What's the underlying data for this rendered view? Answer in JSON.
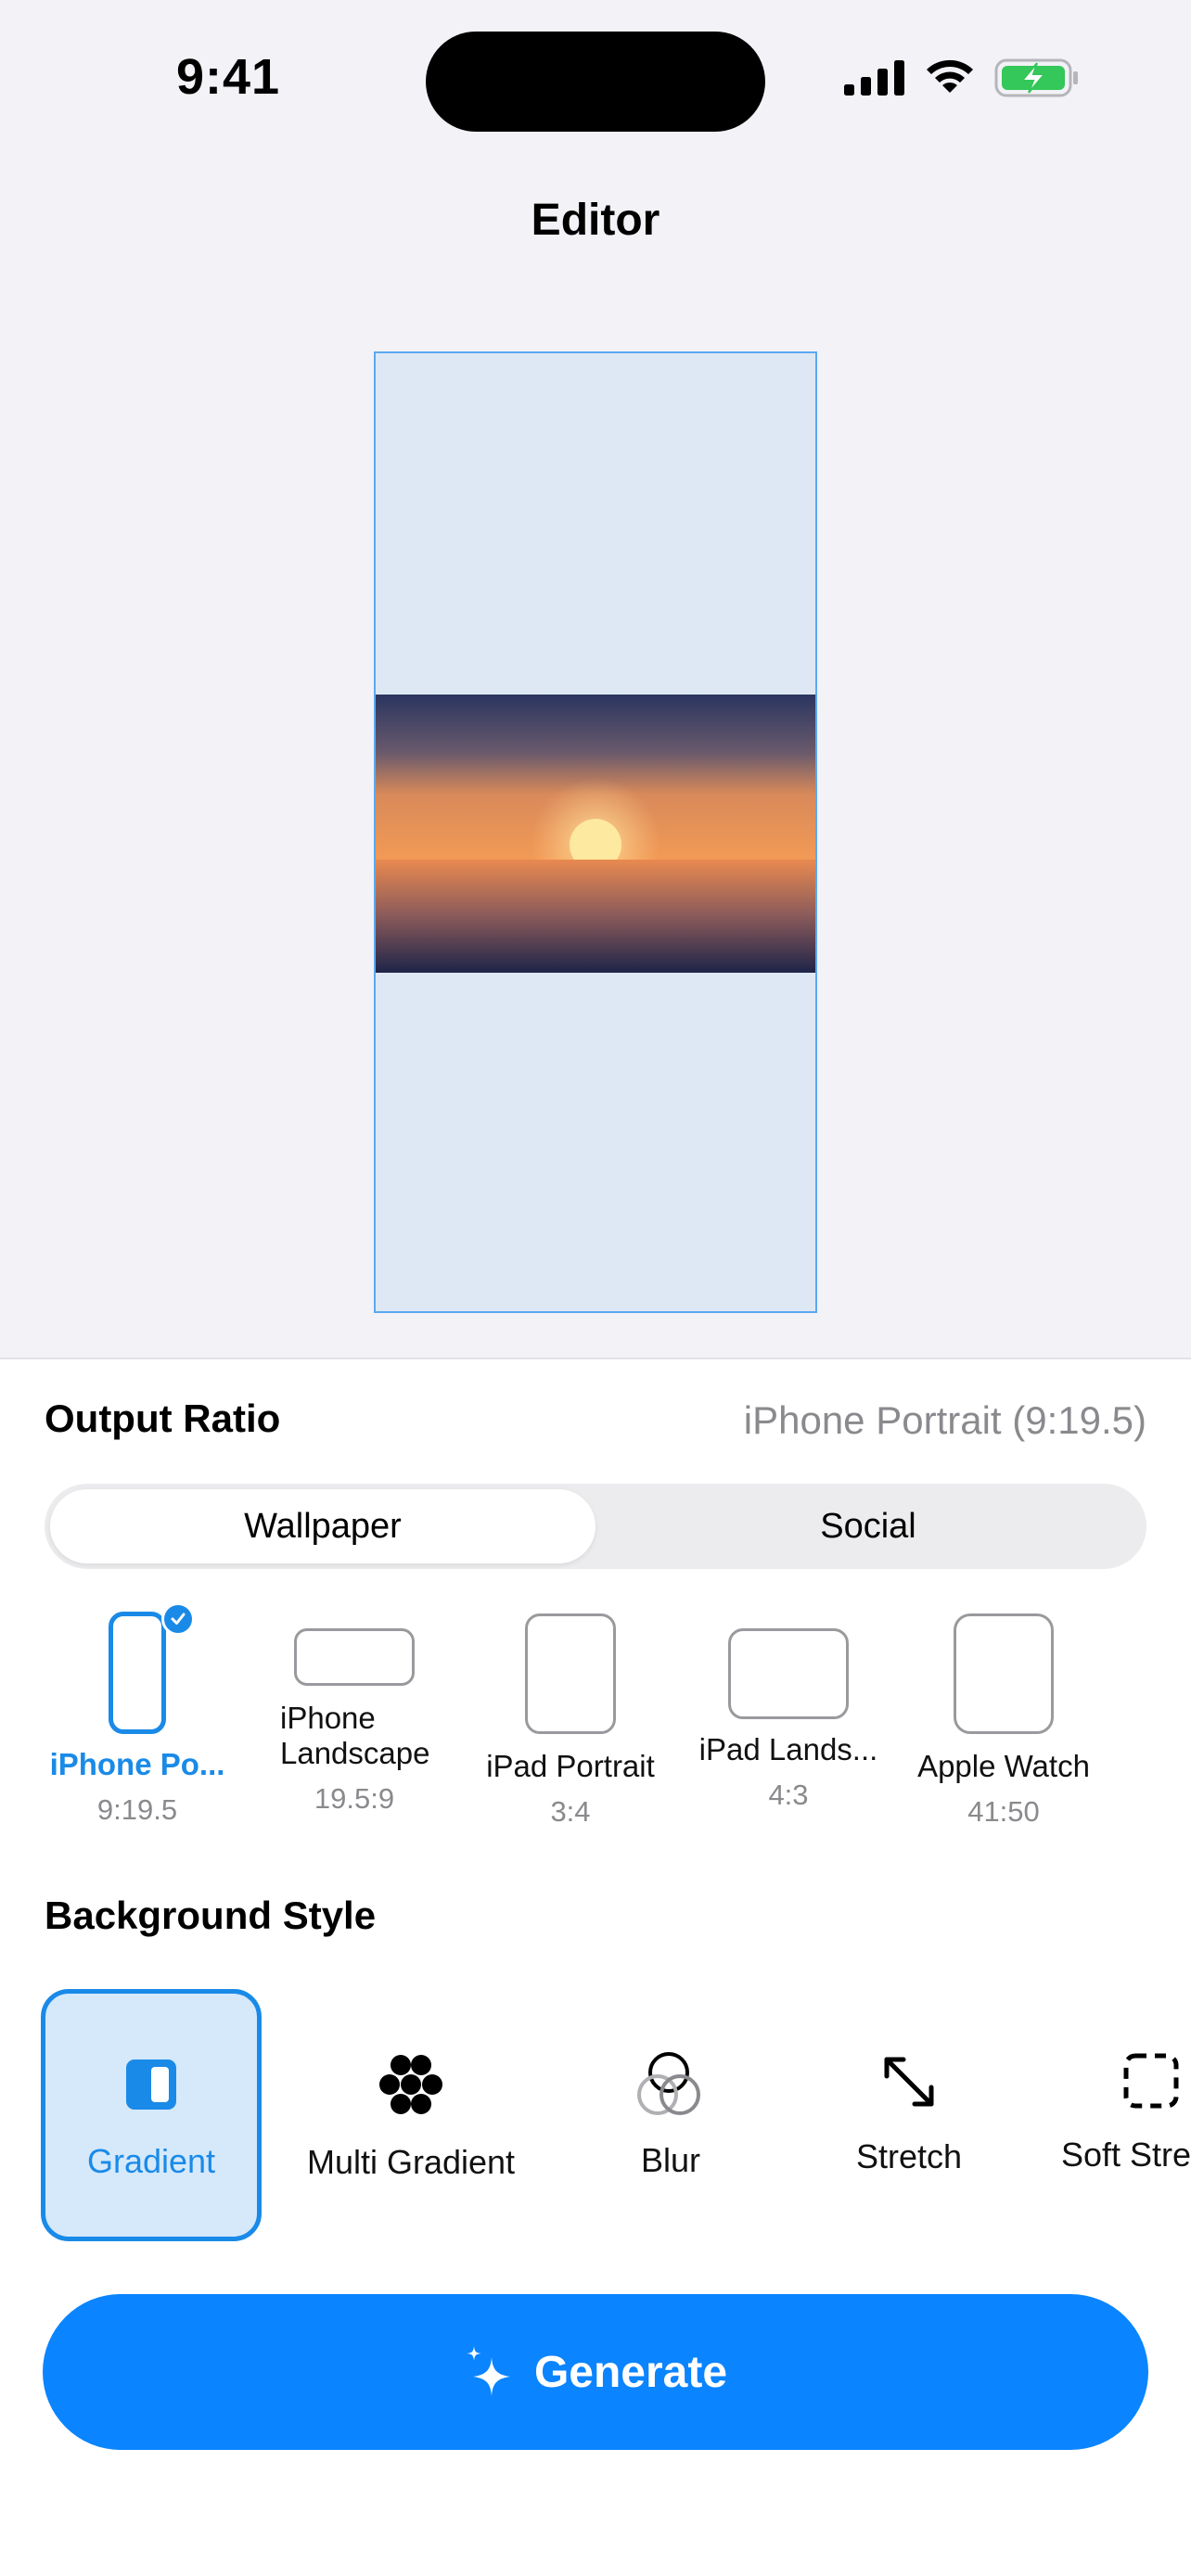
{
  "status_bar": {
    "time": "9:41"
  },
  "nav": {
    "title": "Editor"
  },
  "output_ratio": {
    "title": "Output Ratio",
    "current": "iPhone Portrait (9:19.5)",
    "tabs": [
      "Wallpaper",
      "Social"
    ],
    "active_tab": "Wallpaper",
    "devices": [
      {
        "label": "iPhone Po...",
        "ratio": "9:19.5",
        "selected": true
      },
      {
        "label": "iPhone\nLandscape",
        "ratio": "19.5:9",
        "selected": false
      },
      {
        "label": "iPad Portrait",
        "ratio": "3:4",
        "selected": false
      },
      {
        "label": "iPad Lands...",
        "ratio": "4:3",
        "selected": false
      },
      {
        "label": "Apple Watch",
        "ratio": "41:50",
        "selected": false
      }
    ]
  },
  "background_style": {
    "title": "Background Style",
    "options": [
      {
        "label": "Gradient",
        "icon": "gradient-icon",
        "selected": true
      },
      {
        "label": "Multi Gradient",
        "icon": "multi-gradient-icon",
        "selected": false
      },
      {
        "label": "Blur",
        "icon": "blur-icon",
        "selected": false
      },
      {
        "label": "Stretch",
        "icon": "stretch-icon",
        "selected": false
      },
      {
        "label": "Soft Stre",
        "icon": "soft-stretch-icon",
        "selected": false
      }
    ]
  },
  "generate_button": {
    "label": "Generate"
  },
  "colors": {
    "accent": "#0a84ff",
    "selected_text": "#1a8ae8",
    "selected_bg": "#d5e9fb",
    "battery": "#34c759"
  }
}
